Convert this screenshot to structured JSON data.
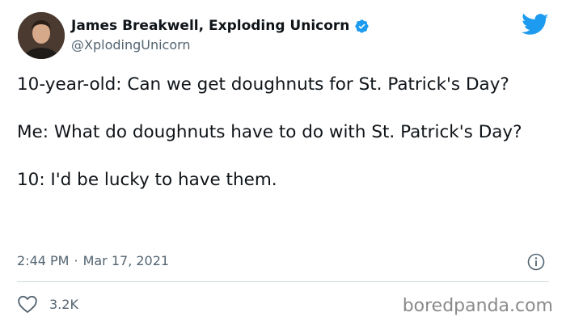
{
  "author": {
    "display_name": "James Breakwell, Exploding Unicorn",
    "handle": "@XplodingUnicorn",
    "verified": true
  },
  "tweet": {
    "paragraphs": [
      "10-year-old: Can we get doughnuts for St. Patrick's Day?",
      "Me: What do doughnuts have to do with St. Patrick's Day?",
      "10: I'd be lucky to have them."
    ],
    "time": "2:44 PM",
    "separator": "·",
    "date": "Mar 17, 2021"
  },
  "engagement": {
    "likes": "3.2K"
  },
  "watermark": "boredpanda.com",
  "colors": {
    "twitter_blue": "#1d9bf0",
    "text_primary": "#0f1419",
    "text_secondary": "#536471",
    "divider": "#cfd9de"
  },
  "icons": [
    "twitter-bird-icon",
    "verified-badge-icon",
    "info-icon",
    "heart-icon"
  ]
}
